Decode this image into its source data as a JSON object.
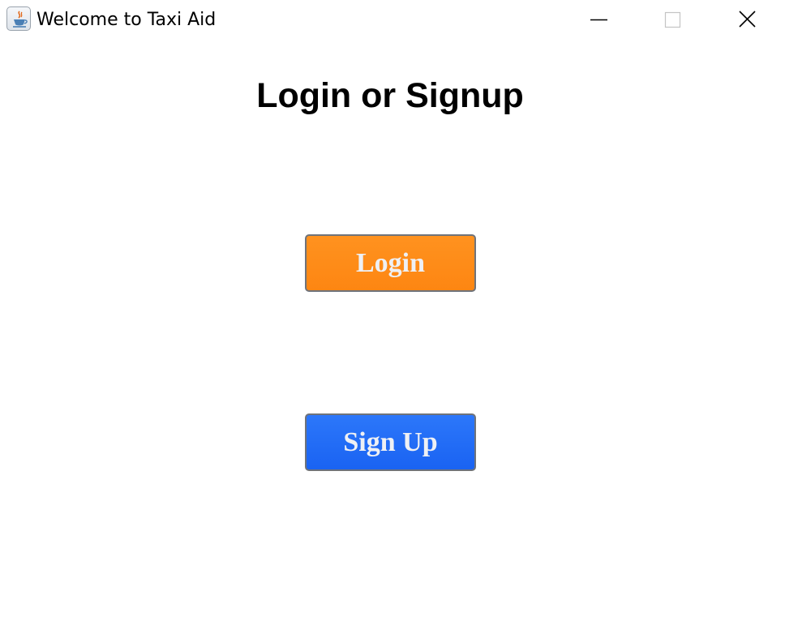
{
  "window": {
    "title": "Welcome to Taxi Aid",
    "app_icon": "java-cup-icon",
    "controls": [
      "minimize-icon",
      "maximize-icon",
      "close-icon"
    ]
  },
  "main": {
    "heading": "Login or Signup",
    "login_label": "Login",
    "signup_label": "Sign Up"
  },
  "colors": {
    "login_button": "#fd8a16",
    "signup_button": "#2269f6",
    "button_text": "#eef0f4",
    "background": "#ffffff"
  }
}
